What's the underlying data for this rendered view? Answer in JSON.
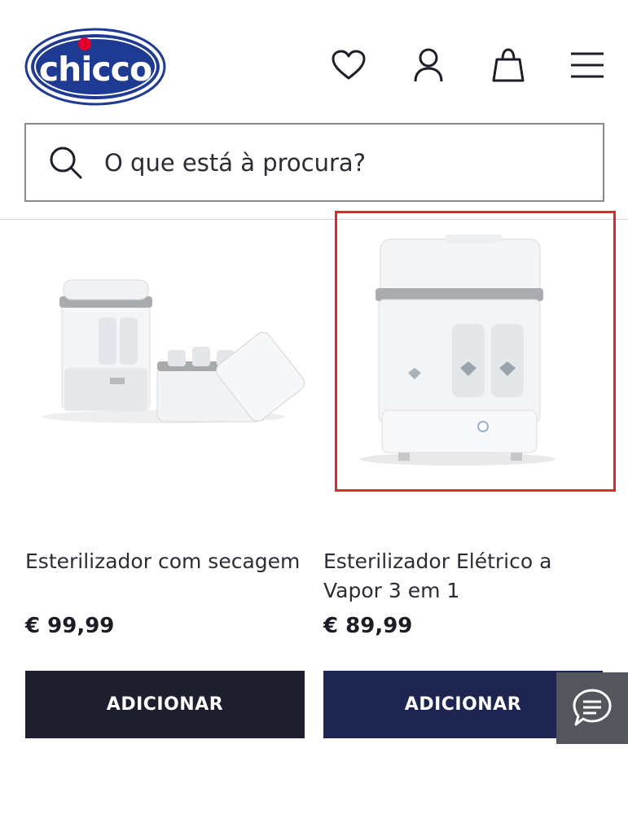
{
  "brand": {
    "logo_text": "chicco"
  },
  "header": {
    "icons": [
      "heart-icon",
      "user-icon",
      "shopping-bag-icon",
      "hamburger-menu-icon"
    ]
  },
  "search": {
    "placeholder": "O que está à procura?"
  },
  "products": [
    {
      "title": "Esterilizador com secagem",
      "price": "€ 99,99",
      "button": "ADICIONAR",
      "highlighted": false
    },
    {
      "title": "Esterilizador Elétrico a Vapor 3 em 1",
      "price": "€ 89,99",
      "button": "ADICIONAR",
      "highlighted": true
    }
  ],
  "colors": {
    "brand_blue": "#1f3a93",
    "brand_red": "#e4002b",
    "button_dark": "#1d1f2f",
    "button_navy": "#1d2550",
    "highlight_red": "#e0282b",
    "chat_bg": "#53565c"
  }
}
